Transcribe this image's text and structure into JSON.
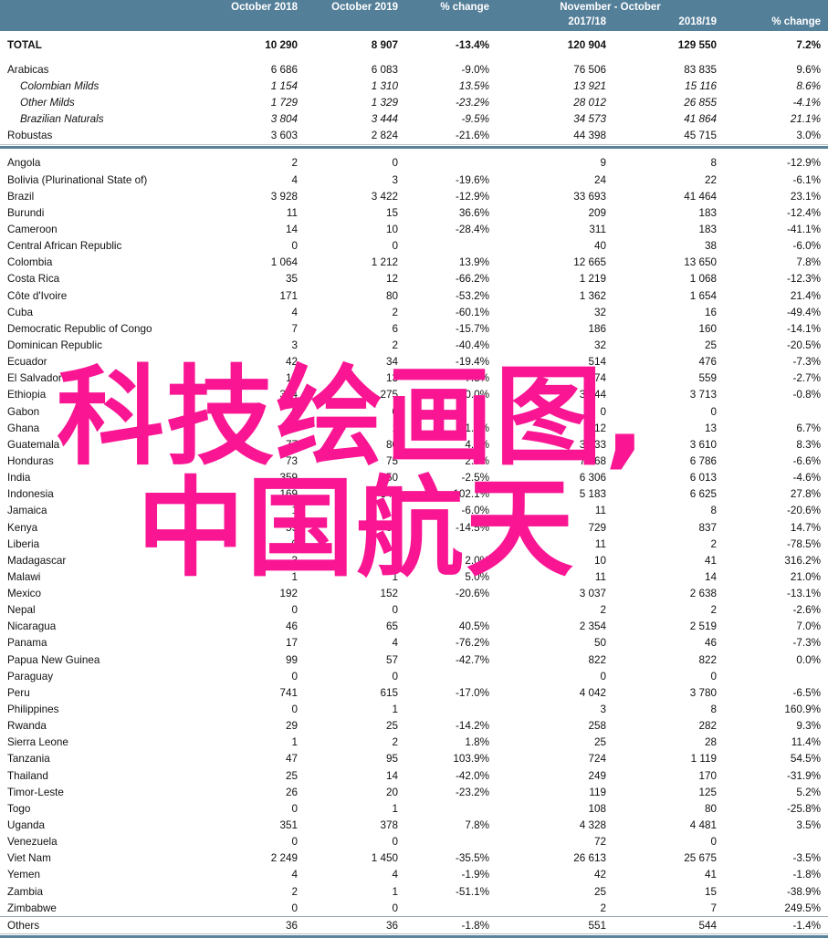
{
  "header": {
    "row1": [
      "",
      "October 2018",
      "October 2019",
      "% change",
      "November - October",
      ""
    ],
    "row2": [
      "",
      "",
      "",
      "",
      "2017/18",
      "2018/19",
      "% change"
    ],
    "group_label": "November - October",
    "col_oct2018": "October 2018",
    "col_oct2019": "October 2019",
    "col_pct_change_1": "% change",
    "col_201718": "2017/18",
    "col_201819": "2018/19",
    "col_pct_change_2": "% change",
    "background_color": "#547f99",
    "text_color": "#ffffff"
  },
  "watermark": {
    "line1": "科技绘画图,",
    "line2": "中国航天",
    "color": "#fa1593"
  },
  "rows": [
    {
      "name": "TOTAL",
      "style": "total",
      "v": [
        "10 290",
        "8 907",
        "-13.4%",
        "120 904",
        "129 550",
        "7.2%"
      ]
    },
    {
      "name": "Arabicas",
      "style": "plain",
      "v": [
        "6 686",
        "6 083",
        "-9.0%",
        "76 506",
        "83 835",
        "9.6%"
      ]
    },
    {
      "name": "Colombian Milds",
      "style": "italic",
      "v": [
        "1 154",
        "1 310",
        "13.5%",
        "13 921",
        "15 116",
        "8.6%"
      ]
    },
    {
      "name": "Other Milds",
      "style": "italic",
      "v": [
        "1 729",
        "1 329",
        "-23.2%",
        "28 012",
        "26 855",
        "-4.1%"
      ]
    },
    {
      "name": "Brazilian Naturals",
      "style": "italic",
      "v": [
        "3 804",
        "3 444",
        "-9.5%",
        "34 573",
        "41 864",
        "21.1%"
      ]
    },
    {
      "name": "Robustas",
      "style": "plain",
      "v": [
        "3 603",
        "2 824",
        "-21.6%",
        "44 398",
        "45 715",
        "3.0%"
      ]
    },
    {
      "name": "Angola",
      "style": "plain",
      "v": [
        "2",
        "0",
        "",
        "9",
        "8",
        "-12.9%"
      ]
    },
    {
      "name": "Bolivia (Plurinational State of)",
      "style": "plain",
      "v": [
        "4",
        "3",
        "-19.6%",
        "24",
        "22",
        "-6.1%"
      ]
    },
    {
      "name": "Brazil",
      "style": "plain",
      "v": [
        "3 928",
        "3 422",
        "-12.9%",
        "33 693",
        "41 464",
        "23.1%"
      ]
    },
    {
      "name": "Burundi",
      "style": "plain",
      "v": [
        "11",
        "15",
        "36.6%",
        "209",
        "183",
        "-12.4%"
      ]
    },
    {
      "name": "Cameroon",
      "style": "plain",
      "v": [
        "14",
        "10",
        "-28.4%",
        "311",
        "183",
        "-41.1%"
      ]
    },
    {
      "name": "Central African Republic",
      "style": "plain",
      "v": [
        "0",
        "0",
        "",
        "40",
        "38",
        "-6.0%"
      ]
    },
    {
      "name": "Colombia",
      "style": "plain",
      "v": [
        "1 064",
        "1 212",
        "13.9%",
        "12 665",
        "13 650",
        "7.8%"
      ]
    },
    {
      "name": "Costa Rica",
      "style": "plain",
      "v": [
        "35",
        "12",
        "-66.2%",
        "1 219",
        "1 068",
        "-12.3%"
      ]
    },
    {
      "name": "Côte d'Ivoire",
      "style": "plain",
      "v": [
        "171",
        "80",
        "-53.2%",
        "1 362",
        "1 654",
        "21.4%"
      ]
    },
    {
      "name": "Cuba",
      "style": "plain",
      "v": [
        "4",
        "2",
        "-60.1%",
        "32",
        "16",
        "-49.4%"
      ]
    },
    {
      "name": "Democratic Republic of Congo",
      "style": "plain",
      "v": [
        "7",
        "6",
        "-15.7%",
        "186",
        "160",
        "-14.1%"
      ]
    },
    {
      "name": "Dominican Republic",
      "style": "plain",
      "v": [
        "3",
        "2",
        "-40.4%",
        "32",
        "25",
        "-20.5%"
      ]
    },
    {
      "name": "Ecuador",
      "style": "plain",
      "v": [
        "42",
        "34",
        "-19.4%",
        "514",
        "476",
        "-7.3%"
      ]
    },
    {
      "name": "El Salvador",
      "style": "plain",
      "v": [
        "14",
        "13",
        "-7.8%",
        "574",
        "559",
        "-2.7%"
      ]
    },
    {
      "name": "Ethiopia",
      "style": "plain",
      "v": [
        "344",
        "275",
        "-20.0%",
        "3 744",
        "3 713",
        "-0.8%"
      ]
    },
    {
      "name": "Gabon",
      "style": "plain",
      "v": [
        "0",
        "0",
        "",
        "0",
        "0",
        ""
      ]
    },
    {
      "name": "Ghana",
      "style": "plain",
      "v": [
        "1",
        "1",
        "1.1%",
        "12",
        "13",
        "6.7%"
      ]
    },
    {
      "name": "Guatemala",
      "style": "plain",
      "v": [
        "77",
        "80",
        "4.5%",
        "3 333",
        "3 610",
        "8.3%"
      ]
    },
    {
      "name": "Honduras",
      "style": "plain",
      "v": [
        "73",
        "75",
        "2.0%",
        "7 268",
        "6 786",
        "-6.6%"
      ]
    },
    {
      "name": "India",
      "style": "plain",
      "v": [
        "359",
        "350",
        "-2.5%",
        "6 306",
        "6 013",
        "-4.6%"
      ]
    },
    {
      "name": "Indonesia",
      "style": "plain",
      "v": [
        "169",
        "342",
        "102.1%",
        "5 183",
        "6 625",
        "27.8%"
      ]
    },
    {
      "name": "Jamaica",
      "style": "plain",
      "v": [
        "1",
        "1",
        "-6.0%",
        "11",
        "8",
        "-20.6%"
      ]
    },
    {
      "name": "Kenya",
      "style": "plain",
      "v": [
        "59",
        "50",
        "-14.5%",
        "729",
        "837",
        "14.7%"
      ]
    },
    {
      "name": "Liberia",
      "style": "plain",
      "v": [
        "0",
        "0",
        "",
        "11",
        "2",
        "-78.5%"
      ]
    },
    {
      "name": "Madagascar",
      "style": "plain",
      "v": [
        "3",
        "3",
        "2.0%",
        "10",
        "41",
        "316.2%"
      ]
    },
    {
      "name": "Malawi",
      "style": "plain",
      "v": [
        "1",
        "1",
        "5.0%",
        "11",
        "14",
        "21.0%"
      ]
    },
    {
      "name": "Mexico",
      "style": "plain",
      "v": [
        "192",
        "152",
        "-20.6%",
        "3 037",
        "2 638",
        "-13.1%"
      ]
    },
    {
      "name": "Nepal",
      "style": "plain",
      "v": [
        "0",
        "0",
        "",
        "2",
        "2",
        "-2.6%"
      ]
    },
    {
      "name": "Nicaragua",
      "style": "plain",
      "v": [
        "46",
        "65",
        "40.5%",
        "2 354",
        "2 519",
        "7.0%"
      ]
    },
    {
      "name": "Panama",
      "style": "plain",
      "v": [
        "17",
        "4",
        "-76.2%",
        "50",
        "46",
        "-7.3%"
      ]
    },
    {
      "name": "Papua New Guinea",
      "style": "plain",
      "v": [
        "99",
        "57",
        "-42.7%",
        "822",
        "822",
        "0.0%"
      ]
    },
    {
      "name": "Paraguay",
      "style": "plain",
      "v": [
        "0",
        "0",
        "",
        "0",
        "0",
        ""
      ]
    },
    {
      "name": "Peru",
      "style": "plain",
      "v": [
        "741",
        "615",
        "-17.0%",
        "4 042",
        "3 780",
        "-6.5%"
      ]
    },
    {
      "name": "Philippines",
      "style": "plain",
      "v": [
        "0",
        "1",
        "",
        "3",
        "8",
        "160.9%"
      ]
    },
    {
      "name": "Rwanda",
      "style": "plain",
      "v": [
        "29",
        "25",
        "-14.2%",
        "258",
        "282",
        "9.3%"
      ]
    },
    {
      "name": "Sierra Leone",
      "style": "plain",
      "v": [
        "1",
        "2",
        "1.8%",
        "25",
        "28",
        "11.4%"
      ]
    },
    {
      "name": "Tanzania",
      "style": "plain",
      "v": [
        "47",
        "95",
        "103.9%",
        "724",
        "1 119",
        "54.5%"
      ]
    },
    {
      "name": "Thailand",
      "style": "plain",
      "v": [
        "25",
        "14",
        "-42.0%",
        "249",
        "170",
        "-31.9%"
      ]
    },
    {
      "name": "Timor-Leste",
      "style": "plain",
      "v": [
        "26",
        "20",
        "-23.2%",
        "119",
        "125",
        "5.2%"
      ]
    },
    {
      "name": "Togo",
      "style": "plain",
      "v": [
        "0",
        "1",
        "",
        "108",
        "80",
        "-25.8%"
      ]
    },
    {
      "name": "Uganda",
      "style": "plain",
      "v": [
        "351",
        "378",
        "7.8%",
        "4 328",
        "4 481",
        "3.5%"
      ]
    },
    {
      "name": "Venezuela",
      "style": "plain",
      "v": [
        "0",
        "0",
        "",
        "72",
        "0",
        ""
      ]
    },
    {
      "name": "Viet Nam",
      "style": "plain",
      "v": [
        "2 249",
        "1 450",
        "-35.5%",
        "26 613",
        "25 675",
        "-3.5%"
      ]
    },
    {
      "name": "Yemen",
      "style": "plain",
      "v": [
        "4",
        "4",
        "-1.9%",
        "42",
        "41",
        "-1.8%"
      ]
    },
    {
      "name": "Zambia",
      "style": "plain",
      "v": [
        "2",
        "1",
        "-51.1%",
        "25",
        "15",
        "-38.9%"
      ]
    },
    {
      "name": "Zimbabwe",
      "style": "plain",
      "v": [
        "0",
        "0",
        "",
        "2",
        "7",
        "249.5%"
      ]
    },
    {
      "name": "Others",
      "style": "plain",
      "v": [
        "36",
        "36",
        "-1.8%",
        "551",
        "544",
        "-1.4%"
      ]
    }
  ]
}
